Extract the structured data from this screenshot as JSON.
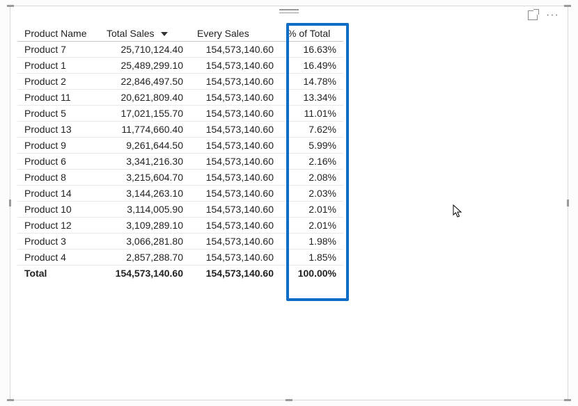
{
  "columns": {
    "name": "Product Name",
    "sales": "Total Sales",
    "every": "Every Sales",
    "pct": "% of Total"
  },
  "rows": [
    {
      "name": "Product 7",
      "sales": "25,710,124.40",
      "every": "154,573,140.60",
      "pct": "16.63%"
    },
    {
      "name": "Product 1",
      "sales": "25,489,299.10",
      "every": "154,573,140.60",
      "pct": "16.49%"
    },
    {
      "name": "Product 2",
      "sales": "22,846,497.50",
      "every": "154,573,140.60",
      "pct": "14.78%"
    },
    {
      "name": "Product 11",
      "sales": "20,621,809.40",
      "every": "154,573,140.60",
      "pct": "13.34%"
    },
    {
      "name": "Product 5",
      "sales": "17,021,155.70",
      "every": "154,573,140.60",
      "pct": "11.01%"
    },
    {
      "name": "Product 13",
      "sales": "11,774,660.40",
      "every": "154,573,140.60",
      "pct": "7.62%"
    },
    {
      "name": "Product 9",
      "sales": "9,261,644.50",
      "every": "154,573,140.60",
      "pct": "5.99%"
    },
    {
      "name": "Product 6",
      "sales": "3,341,216.30",
      "every": "154,573,140.60",
      "pct": "2.16%"
    },
    {
      "name": "Product 8",
      "sales": "3,215,604.70",
      "every": "154,573,140.60",
      "pct": "2.08%"
    },
    {
      "name": "Product 14",
      "sales": "3,144,263.10",
      "every": "154,573,140.60",
      "pct": "2.03%"
    },
    {
      "name": "Product 10",
      "sales": "3,114,005.90",
      "every": "154,573,140.60",
      "pct": "2.01%"
    },
    {
      "name": "Product 12",
      "sales": "3,109,289.10",
      "every": "154,573,140.60",
      "pct": "2.01%"
    },
    {
      "name": "Product 3",
      "sales": "3,066,281.80",
      "every": "154,573,140.60",
      "pct": "1.98%"
    },
    {
      "name": "Product 4",
      "sales": "2,857,288.70",
      "every": "154,573,140.60",
      "pct": "1.85%"
    }
  ],
  "total": {
    "label": "Total",
    "sales": "154,573,140.60",
    "every": "154,573,140.60",
    "pct": "100.00%"
  },
  "chart_data": {
    "type": "table",
    "title": "",
    "columns": [
      "Product Name",
      "Total Sales",
      "Every Sales",
      "% of Total"
    ],
    "sorted_by": "Total Sales",
    "sort_direction": "desc",
    "rows": [
      [
        "Product 7",
        25710124.4,
        154573140.6,
        16.63
      ],
      [
        "Product 1",
        25489299.1,
        154573140.6,
        16.49
      ],
      [
        "Product 2",
        22846497.5,
        154573140.6,
        14.78
      ],
      [
        "Product 11",
        20621809.4,
        154573140.6,
        13.34
      ],
      [
        "Product 5",
        17021155.7,
        154573140.6,
        11.01
      ],
      [
        "Product 13",
        11774660.4,
        154573140.6,
        7.62
      ],
      [
        "Product 9",
        9261644.5,
        154573140.6,
        5.99
      ],
      [
        "Product 6",
        3341216.3,
        154573140.6,
        2.16
      ],
      [
        "Product 8",
        3215604.7,
        154573140.6,
        2.08
      ],
      [
        "Product 14",
        3144263.1,
        154573140.6,
        2.03
      ],
      [
        "Product 10",
        3114005.9,
        154573140.6,
        2.01
      ],
      [
        "Product 12",
        3109289.1,
        154573140.6,
        2.01
      ],
      [
        "Product 3",
        3066281.8,
        154573140.6,
        1.98
      ],
      [
        "Product 4",
        2857288.7,
        154573140.6,
        1.85
      ]
    ],
    "totals": [
      "Total",
      154573140.6,
      154573140.6,
      100.0
    ]
  }
}
